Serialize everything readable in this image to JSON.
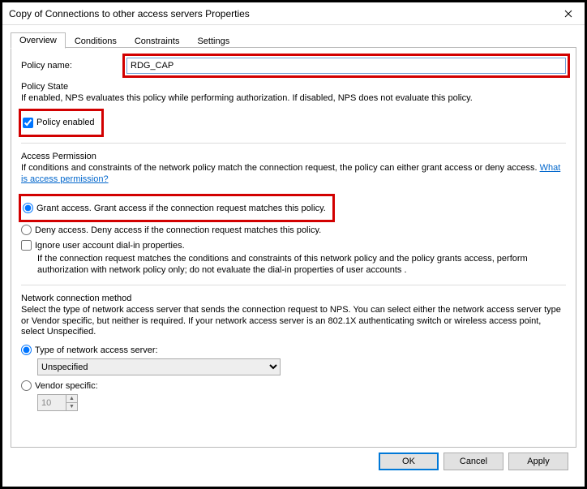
{
  "window": {
    "title": "Copy of Connections to other access servers Properties"
  },
  "tabs": {
    "overview": "Overview",
    "conditions": "Conditions",
    "constraints": "Constraints",
    "settings": "Settings"
  },
  "policy_name": {
    "label": "Policy name:",
    "value": "RDG_CAP"
  },
  "policy_state": {
    "title": "Policy State",
    "desc": "If enabled, NPS evaluates this policy while performing authorization. If disabled, NPS does not evaluate this policy.",
    "enabled_label": "Policy enabled",
    "enabled_checked": true
  },
  "access_permission": {
    "title": "Access Permission",
    "desc_prefix": "If conditions and constraints of the network policy match the connection request, the policy can either grant access or deny access. ",
    "link_text": "What is access permission?",
    "grant_label": "Grant access. Grant access if the connection request matches this policy.",
    "deny_label": "Deny access. Deny access if the connection request matches this policy.",
    "ignore_label": "Ignore user account dial-in properties.",
    "ignore_note": "If the connection request matches the conditions and constraints of this network policy and the policy grants access, perform authorization with network policy only; do not evaluate the dial-in properties of user accounts ."
  },
  "ncm": {
    "title": "Network connection method",
    "desc": "Select the type of network access server that sends the connection request to NPS. You can select either the network access server type or Vendor specific, but neither is required.  If your network access server is an 802.1X authenticating switch or wireless access point, select Unspecified.",
    "type_label": "Type of network access server:",
    "type_value": "Unspecified",
    "vendor_label": "Vendor specific:",
    "vendor_value": "10"
  },
  "buttons": {
    "ok": "OK",
    "cancel": "Cancel",
    "apply": "Apply"
  }
}
